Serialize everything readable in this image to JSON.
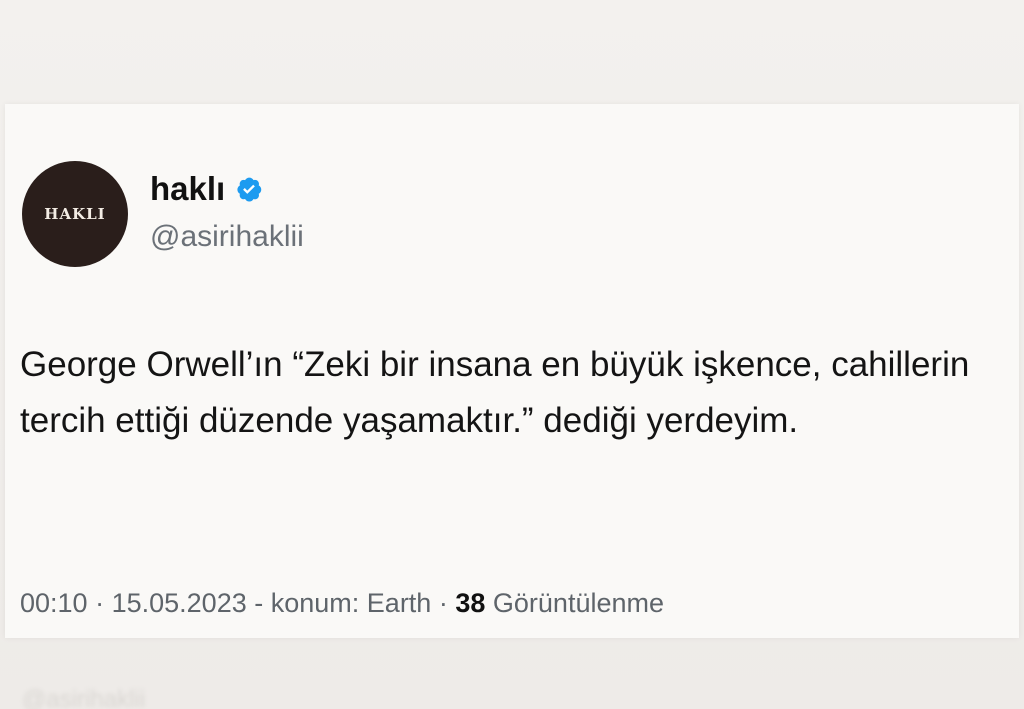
{
  "tweet": {
    "avatar_text": "HAKLI",
    "display_name": "haklı",
    "verified": true,
    "handle": "@asirihaklii",
    "text": "George Orwell’ın “Zeki bir insana en büyük işkence, cahillerin tercih ettiği düzende yaşamaktır.” dediği yerdeyim.",
    "time": "00:10",
    "date": "15.05.2023",
    "location": "konum: Earth",
    "views_count": "38",
    "views_label": "Görüntülenme"
  },
  "watermark": "@asirihaklii",
  "colors": {
    "verified_badge": "#1d9bf0",
    "avatar_bg": "#2a1e1b",
    "card_bg": "#faf9f7"
  },
  "icons": {
    "verified": "verified-badge-icon"
  }
}
